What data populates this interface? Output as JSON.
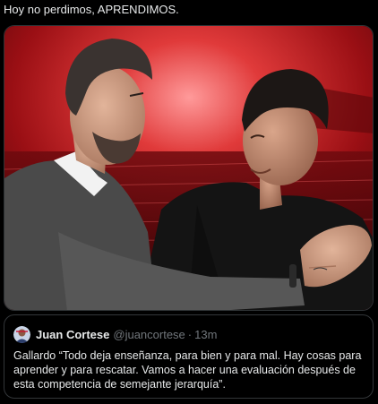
{
  "post": {
    "text": "Hoy no perdimos, APRENDIMOS."
  },
  "media": {
    "description_icon": "photo-two-men-embracing"
  },
  "quote": {
    "author_name": "Juan Cortese",
    "author_handle": "@juancortese",
    "separator": "·",
    "time": "13m",
    "text": "Gallardo “Todo deja enseñanza, para bien y para mal. Hay cosas para aprender y para rescatar. Vamos a hacer una evaluación después de esta competencia de semejante jerarquía”."
  },
  "colors": {
    "background": "#000000",
    "text_primary": "#e7e9ea",
    "text_secondary": "#71767b",
    "border": "#333639",
    "photo_accent": "#c8102e"
  }
}
